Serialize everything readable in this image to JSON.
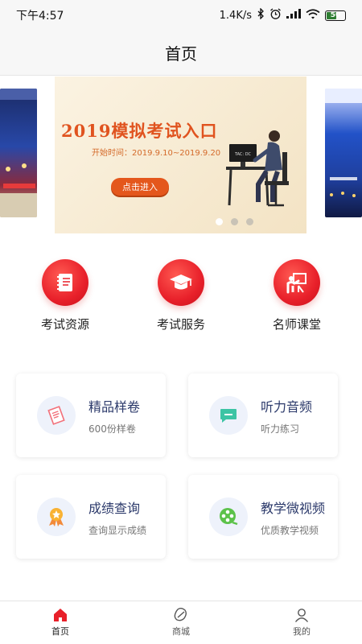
{
  "status_bar": {
    "time": "下午4:57",
    "network_speed": "1.4K/s",
    "battery": "50",
    "battery_level": 0.5
  },
  "header": {
    "title": "首页"
  },
  "banner": {
    "title": "2019模拟考试入口",
    "subtitle": "开始时间：2019.9.10~2019.9.20",
    "button_label": "点击进入",
    "screen_text": "TAC: DC",
    "slide_count": 3,
    "active_index": 0
  },
  "categories": [
    {
      "label": "考试资源",
      "icon": "notebook-icon"
    },
    {
      "label": "考试服务",
      "icon": "graduation-cap-icon"
    },
    {
      "label": "名师课堂",
      "icon": "teacher-icon"
    }
  ],
  "cards": [
    {
      "title": "精品样卷",
      "subtitle": "600份样卷",
      "icon": "paper-icon"
    },
    {
      "title": "听力音频",
      "subtitle": "听力练习",
      "icon": "chat-bubble-icon"
    },
    {
      "title": "成绩查询",
      "subtitle": "查询显示成绩",
      "icon": "medal-icon"
    },
    {
      "title": "教学微视频",
      "subtitle": "优质教学视频",
      "icon": "film-reel-icon"
    }
  ],
  "bottom_nav": [
    {
      "label": "首页",
      "icon": "home-icon",
      "active": true
    },
    {
      "label": "商城",
      "icon": "shop-icon",
      "active": false
    },
    {
      "label": "我的",
      "icon": "person-icon",
      "active": false
    }
  ],
  "colors": {
    "accent_red": "#e8202a",
    "banner_orange": "#e0531f",
    "card_title": "#2c3a6b",
    "card_icon_bg": "#eef2fb"
  }
}
